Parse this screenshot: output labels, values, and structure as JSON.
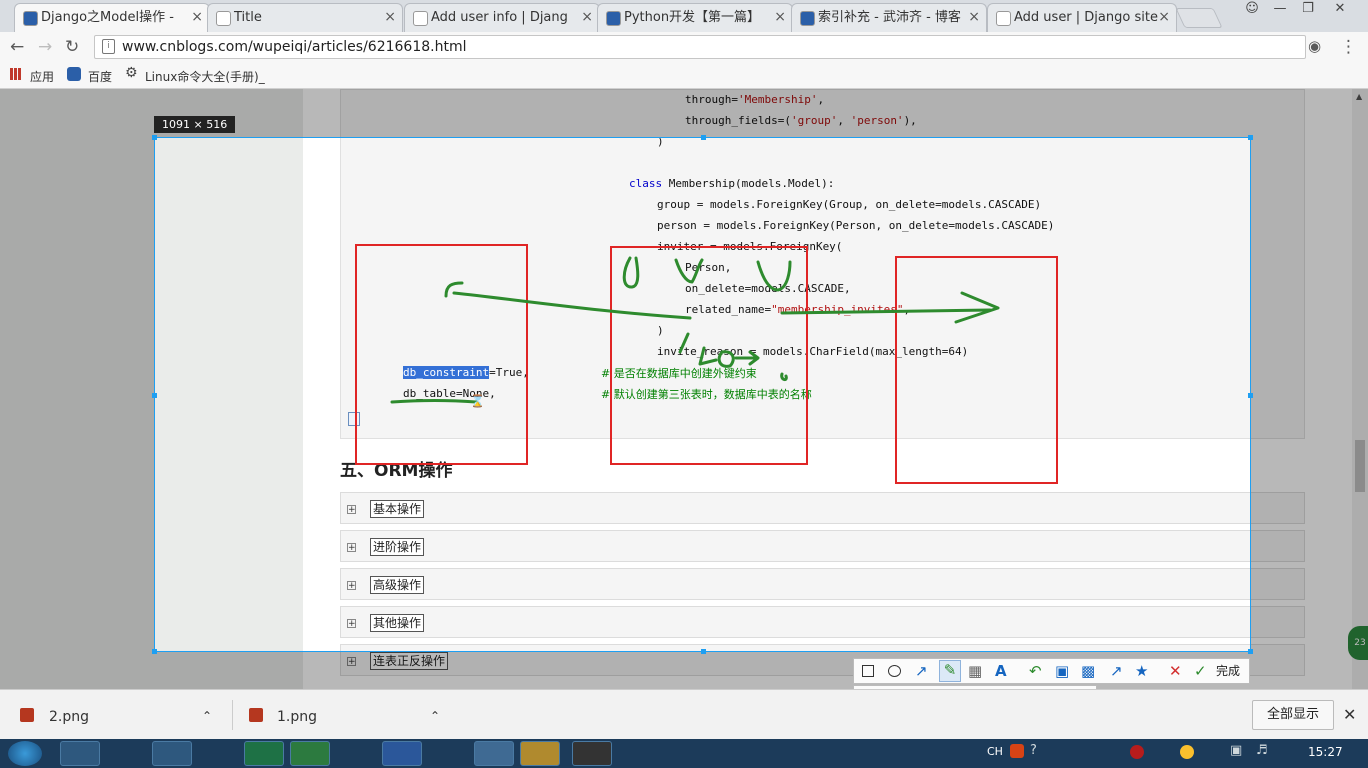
{
  "tabs": [
    {
      "title": "Django之Model操作 - ",
      "active": true,
      "favicon_color": "#2b5fa8"
    },
    {
      "title": "Title",
      "active": false,
      "favicon_color": "#ffffff"
    },
    {
      "title": "Add user info | Djang",
      "active": false,
      "favicon_color": "#ffffff"
    },
    {
      "title": "Python开发【第一篇】",
      "active": false,
      "favicon_color": "#2b5fa8"
    },
    {
      "title": "索引补充 - 武沛齐 - 博客",
      "active": false,
      "favicon_color": "#2b5fa8"
    },
    {
      "title": "Add user | Django site",
      "active": false,
      "favicon_color": "#ffffff"
    }
  ],
  "nav": {
    "url": "www.cnblogs.com/wupeiqi/articles/6216618.html"
  },
  "bookmarks": [
    {
      "label": "应用",
      "icon": "apps-grid-icon"
    },
    {
      "label": "百度",
      "icon": "baidu-paw-icon"
    },
    {
      "label": "Linux命令大全(手册)_",
      "icon": "linux-cmd-icon"
    }
  ],
  "code": {
    "through": "through=",
    "through_val": "'Membership'",
    "through_tail": ",",
    "through_fields_a": "through_fields=(",
    "through_fields_b": "'group'",
    "through_fields_c": ", ",
    "through_fields_d": "'person'",
    "through_fields_e": "),",
    "close_paren_1": ")",
    "class_kw": "class",
    "class_rest": " Membership(models.Model):",
    "group_line": "group = models.ForeignKey(Group, on_delete=models.CASCADE)",
    "person_line": "person = models.ForeignKey(Person, on_delete=models.CASCADE)",
    "inviter_line": "inviter = models.ForeignKey(",
    "person_arg": "Person,",
    "on_delete_arg": "on_delete=models.CASCADE,",
    "related_a": "related_name=",
    "related_b": "\"membership_invites\"",
    "related_c": ",",
    "close_paren_2": ")",
    "invite_reason": "invite_reason = models.CharField(max_length=64)",
    "db_constraint_hl": "db_constraint",
    "db_constraint_rest": "=True,",
    "db_constraint_cmt": "# 是否在数据库中创建外键约束",
    "db_table": "db_table=None,",
    "db_table_cmt": "# 默认创建第三张表时，数据库中表的名称"
  },
  "section_title": "五、ORM操作",
  "folds": [
    "基本操作",
    "进阶操作",
    "高级操作",
    "其他操作",
    "连表正反操作"
  ],
  "capture": {
    "size_label": "1091 × 516",
    "done_label": "完成",
    "accent": "#1e9ff2",
    "annotation_red": "#e02525",
    "annotation_green": "#2e8b2e",
    "palette": [
      "#000000",
      "#808080",
      "#800000",
      "#808000",
      "#008000",
      "#000080",
      "#800080",
      "#008080",
      "#ffffff",
      "#c0c0c0",
      "#ff0000",
      "#ffff00",
      "#00ff00",
      "#0000ff",
      "#ff00ff",
      "#00ffff"
    ],
    "current_color": "#2e8b2e"
  },
  "downloads": [
    {
      "name": "2.png"
    },
    {
      "name": "1.png"
    }
  ],
  "downloads_show_all": "全部显示",
  "taskbar": {
    "lang": "CH",
    "clock": "15:27"
  }
}
